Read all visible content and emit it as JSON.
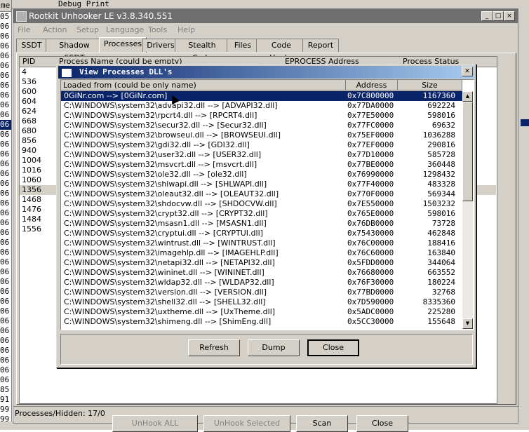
{
  "background": {
    "left_header": "me",
    "left_rows": [
      "05",
      "06",
      "06",
      "06",
      "06",
      "06",
      "06",
      "06",
      "06",
      "06",
      "06",
      "06",
      "06",
      "06",
      "06",
      "06",
      "06",
      "06",
      "06",
      "06",
      "06",
      "06",
      "06",
      "06",
      "06",
      "06",
      "06",
      "06",
      "06",
      "06",
      "06",
      "06",
      "06",
      "06",
      "06",
      "06",
      "06",
      "06",
      "85",
      "91",
      "99",
      "99"
    ],
    "top_header": "Debug Print"
  },
  "window": {
    "title": "Rootkit Unhooker LE v3.8.340.551",
    "caption_buttons": [
      "_",
      "□",
      "×"
    ]
  },
  "menu": [
    "File",
    "Action",
    "Setup",
    "Language",
    "Tools",
    "Help"
  ],
  "tabs": [
    "SSDT",
    "Shadow SSDT",
    "Processes",
    "Drivers",
    "Stealth Code",
    "Files",
    "Code Hooks",
    "Report"
  ],
  "active_tab": "Processes",
  "process_list": {
    "headers": {
      "pid": "PID",
      "path": "Process Name (could be empty)",
      "eprocess": "EPROCESS Address",
      "status": "Process Status"
    },
    "pids": [
      "4",
      "536",
      "600",
      "604",
      "624",
      "668",
      "680",
      "856",
      "940",
      "1004",
      "1016",
      "1060",
      "1356",
      "1468",
      "1476",
      "1484",
      "1556"
    ]
  },
  "buttons": {
    "unhook_all": "UnHook ALL",
    "unhook_selected": "UnHook Selected",
    "scan": "Scan",
    "close": "Close"
  },
  "status": "Processes/Hidden: 17/0",
  "dialog": {
    "title": "View Processes DLL's",
    "columns": {
      "loaded_from": "Loaded from (could be only name)",
      "address": "Address",
      "size": "Size"
    },
    "rows": [
      {
        "path": "0GiNr.com --> [0GiNr.com]",
        "address": "0x7C800000",
        "size": "1167360"
      },
      {
        "path": "C:\\WINDOWS\\system32\\advapi32.dll --> [ADVAPI32.dll]",
        "address": "0x77DA0000",
        "size": "692224"
      },
      {
        "path": "C:\\WINDOWS\\system32\\rpcrt4.dll --> [RPCRT4.dll]",
        "address": "0x77E50000",
        "size": "598016"
      },
      {
        "path": "C:\\WINDOWS\\system32\\secur32.dll --> [Secur32.dll]",
        "address": "0x77FC0000",
        "size": "69632"
      },
      {
        "path": "C:\\WINDOWS\\system32\\browseui.dll --> [BROWSEUI.dll]",
        "address": "0x75EF0000",
        "size": "1036288"
      },
      {
        "path": "C:\\WINDOWS\\system32\\gdi32.dll --> [GDI32.dll]",
        "address": "0x77EF0000",
        "size": "290816"
      },
      {
        "path": "C:\\WINDOWS\\system32\\user32.dll --> [USER32.dll]",
        "address": "0x77D10000",
        "size": "585728"
      },
      {
        "path": "C:\\WINDOWS\\system32\\msvcrt.dll --> [msvcrt.dll]",
        "address": "0x77BE0000",
        "size": "360448"
      },
      {
        "path": "C:\\WINDOWS\\system32\\ole32.dll --> [ole32.dll]",
        "address": "0x76990000",
        "size": "1298432"
      },
      {
        "path": "C:\\WINDOWS\\system32\\shlwapi.dll --> [SHLWAPI.dll]",
        "address": "0x77F40000",
        "size": "483328"
      },
      {
        "path": "C:\\WINDOWS\\system32\\oleaut32.dll --> [OLEAUT32.dll]",
        "address": "0x770F0000",
        "size": "569344"
      },
      {
        "path": "C:\\WINDOWS\\system32\\shdocvw.dll --> [SHDOCVW.dll]",
        "address": "0x7E550000",
        "size": "1503232"
      },
      {
        "path": "C:\\WINDOWS\\system32\\crypt32.dll --> [CRYPT32.dll]",
        "address": "0x765E0000",
        "size": "598016"
      },
      {
        "path": "C:\\WINDOWS\\system32\\msasn1.dll --> [MSASN1.dll]",
        "address": "0x76DB0000",
        "size": "73728"
      },
      {
        "path": "C:\\WINDOWS\\system32\\cryptui.dll --> [CRYPTUI.dll]",
        "address": "0x75430000",
        "size": "462848"
      },
      {
        "path": "C:\\WINDOWS\\system32\\wintrust.dll --> [WINTRUST.dll]",
        "address": "0x76C00000",
        "size": "188416"
      },
      {
        "path": "C:\\WINDOWS\\system32\\imagehlp.dll --> [IMAGEHLP.dll]",
        "address": "0x76C60000",
        "size": "163840"
      },
      {
        "path": "C:\\WINDOWS\\system32\\netapi32.dll --> [NETAPI32.dll]",
        "address": "0x5FDD0000",
        "size": "344064"
      },
      {
        "path": "C:\\WINDOWS\\system32\\wininet.dll --> [WININET.dll]",
        "address": "0x76680000",
        "size": "663552"
      },
      {
        "path": "C:\\WINDOWS\\system32\\wldap32.dll --> [WLDAP32.dll]",
        "address": "0x76F30000",
        "size": "180224"
      },
      {
        "path": "C:\\WINDOWS\\system32\\version.dll --> [VERSION.dll]",
        "address": "0x77BD0000",
        "size": "32768"
      },
      {
        "path": "C:\\WINDOWS\\system32\\shell32.dll --> [SHELL32.dll]",
        "address": "0x7D590000",
        "size": "8335360"
      },
      {
        "path": "C:\\WINDOWS\\system32\\uxtheme.dll --> [UxTheme.dll]",
        "address": "0x5ADC0000",
        "size": "225280"
      },
      {
        "path": "C:\\WINDOWS\\system32\\shimeng.dll --> [ShimEng.dll]",
        "address": "0x5CC30000",
        "size": "155648"
      }
    ],
    "buttons": {
      "refresh": "Refresh",
      "dump": "Dump",
      "close": "Close"
    }
  }
}
